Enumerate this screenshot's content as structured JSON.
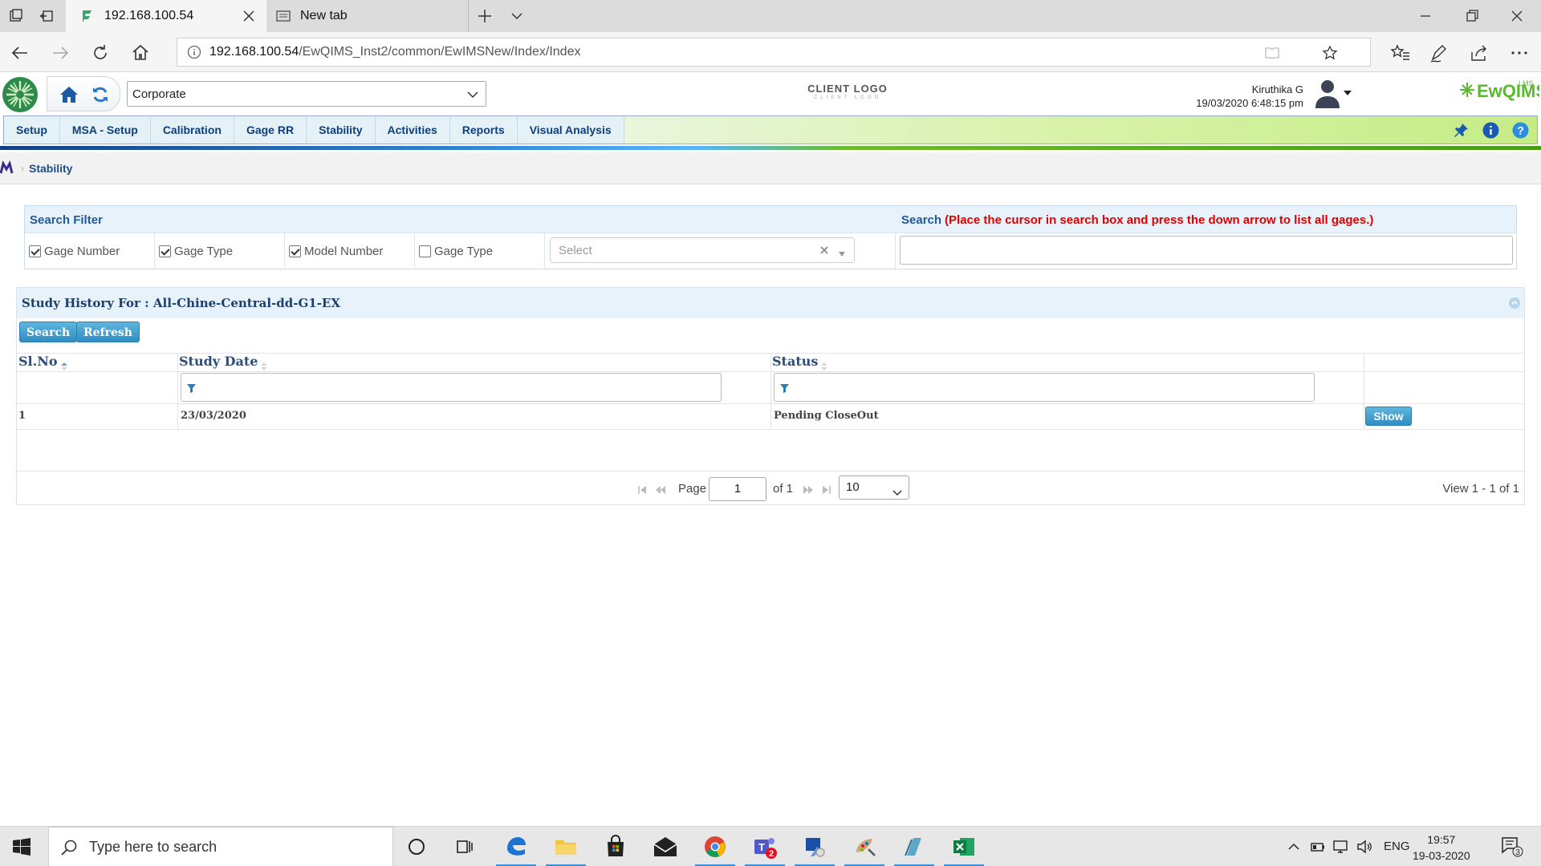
{
  "browser": {
    "tabs": [
      {
        "title": "192.168.100.54",
        "active": true
      },
      {
        "title": "New tab",
        "active": false
      }
    ],
    "address": {
      "host": "192.168.100.54",
      "path": "/EwQIMS_Inst2/common/EwIMSNew/Index/Index"
    }
  },
  "header": {
    "site_select": "Corporate",
    "client_logo": "CLIENT LOGO",
    "client_logo_sub": "CLIENT LOGO",
    "user_name": "Kiruthika G",
    "datetime": "19/03/2020 6:48:15 pm",
    "brand": "EwQIMS",
    "brand_sup": "LMS"
  },
  "menu": {
    "items": [
      "Setup",
      "MSA - Setup",
      "Calibration",
      "Gage RR",
      "Stability",
      "Activities",
      "Reports",
      "Visual Analysis"
    ]
  },
  "breadcrumb": {
    "current": "Stability"
  },
  "filter": {
    "title": "Search Filter",
    "search_label": "Search",
    "search_hint": "(Place the cursor in search box and press the down arrow to list all gages.)",
    "checkboxes": [
      {
        "label": "Gage Number",
        "checked": true
      },
      {
        "label": "Gage Type",
        "checked": true
      },
      {
        "label": "Model Number",
        "checked": true
      },
      {
        "label": "Gage Type",
        "checked": false
      }
    ],
    "select_placeholder": "Select",
    "search_value": ""
  },
  "grid": {
    "title": "Study History For : All-Chine-Central-dd-G1-EX",
    "search_button": "Search",
    "refresh_button": "Refresh",
    "columns": [
      "Sl.No",
      "Study Date",
      "Status"
    ],
    "rows": [
      {
        "slno": "1",
        "date": "23/03/2020",
        "status": "Pending CloseOut",
        "action": "Show"
      }
    ],
    "pager": {
      "page_label": "Page",
      "page": "1",
      "of_label": "of 1",
      "page_size": "10",
      "view": "View 1 - 1 of 1"
    }
  },
  "taskbar": {
    "search_placeholder": "Type here to search",
    "lang": "ENG",
    "time": "19:57",
    "date": "19-03-2020",
    "teams_badge": "2",
    "notif_count": "3"
  }
}
